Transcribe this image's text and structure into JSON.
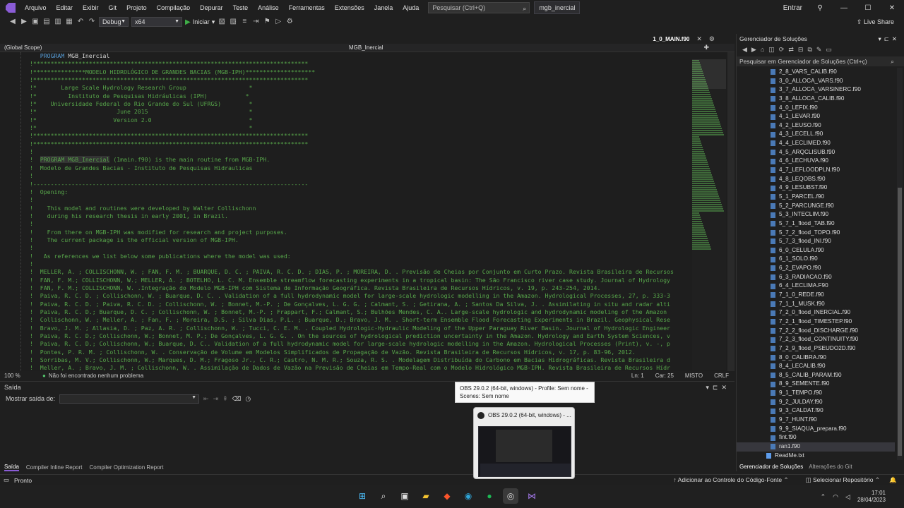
{
  "menu": {
    "items": [
      "Arquivo",
      "Editar",
      "Exibir",
      "Git",
      "Projeto",
      "Compilação",
      "Depurar",
      "Teste",
      "Análise",
      "Ferramentas",
      "Extensões",
      "Janela",
      "Ajuda"
    ],
    "search_placeholder": "Pesquisar (Ctrl+Q)",
    "solution_name": "mgb_inercial",
    "signin": "Entrar"
  },
  "toolbar": {
    "config": "Debug",
    "platform": "x64",
    "start": "Iniciar",
    "live_share": "Live Share"
  },
  "editor": {
    "tab": "1_0_MAIN.f90",
    "scope": "(Global Scope)",
    "member": "MGB_Inercial",
    "lines": [
      "   PROGRAM MGB_Inercial",
      "!*******************************************************************************",
      "!***************MODELO HIDROLÓGICO DE GRANDES BACIAS (MGB-IPH)********************",
      "!*******************************************************************************",
      "!*       Large Scale Hydrology Research Group                  *",
      "!*         Instituto de Pesquisas Hidráulicas (IPH)           *",
      "!*    Universidade Federal do Rio Grande do Sul (UFRGS)        *",
      "!*                       June 2015                             *",
      "!*                      Version 2.0                            *",
      "!*                                                             *",
      "!*******************************************************************************",
      "!*******************************************************************************",
      "!",
      "!  PROGRAM MGB_Inercial (1main.f90) is the main routine from MGB-IPH.",
      "!  Modelo de Grandes Bacias - Instituto de Pesquisas Hidraulicas",
      "!",
      "!-------------------------------------------------------------------------------",
      "!  Opening:",
      "!",
      "!    This model and routines were developed by Walter Collischonn",
      "!    during his research thesis in early 2001, in Brazil.",
      "!",
      "!    From there on MGB-IPH was modified for research and project purposes.",
      "!    The current package is the official version of MGB-IPH.",
      "!",
      "!   As references we list below some publications where the model was used:",
      "!",
      "!  MELLER, A. ; COLLISCHONN, W. ; FAN, F. M. ; BUARQUE, D. C. ; PAIVA, R. C. D. ; DIAS, P. ; MOREIRA, D. . Previsão de Cheias por Conjunto em Curto Prazo. Revista Brasileira de Recursos",
      "!  FAN, F. M.; COLLISCHONN, W.; MELLER, A. ; BOTELHO, L. C. M. Ensemble streamflow forecasting experiments in a tropical basin: The São Francisco river case study. Journal of Hydrology",
      "!  FAN, F. M.; COLLISCHONN, W. .Integração do Modelo MGB-IPH com Sistema de Informação Geográfica. Revista Brasileira de Recursos Hídricos, v. 19, p. 243-254, 2014.",
      "!  Paiva, R. C. D. ; Collischonn, W. ; Buarque, D. C. . Validation of a full hydrodynamic model for large-scale hydrologic modelling in the Amazon. Hydrological Processes, 27, p. 333-3",
      "!  Paiva, R. C. D. ; Paiva, R. C. D. ; Collischonn, W. ; Bonnet, M.-P. ; De Gonçalves, L. G. G. ; Calmant, S. ; Getirana, A. ; Santos Da Silva, J. . Assimilating in situ and radar alti",
      "!  Paiva, R. C. D.; Buarque, D. C. ; Collischonn, W. ; Bonnet, M.-P. ; Frappart, F.; Calmant, S.; Bulhões Mendes, C. A.. Large-scale hydrologic and hydrodynamic modeling of the Amazon",
      "!  Collischonn, W. ; Meller, A. ; Fan, F. ; Moreira, D.S. ; Silva Dias, P.L. ; Buarque, D.; Bravo, J. M. . Short-term Ensemble Flood Forecasting Experiments in Brazil. Geophysical Rese",
      "!  Bravo, J. M. ; Allasia, D. ; Paz, A. R. ; Collischonn, W. ; Tucci, C. E. M. . Coupled Hydrologic-Hydraulic Modeling of the Upper Paraguay River Basin. Journal of Hydrologic Engineer",
      "!  Paiva, R. C. D.; Collischonn, W.; Bonnet, M. P.; De Gonçalves, L. G. G. . On the sources of hydrological prediction uncertainty in the Amazon. Hydrology and Earth System Sciences, v",
      "!  Paiva, R. C. D.; Collischonn, W.; Buarque, D. C.. Validation of a full hydrodynamic model for large-scale hydrologic modelling in the Amazon. Hydrological Processes (Print), v. -, p",
      "!  Pontes, P. R. M. ; Collischonn, W. . Conservação de Volume em Modelos Simplificados de Propagação de Vazão. Revista Brasileira de Recursos Hídricos, v. 17, p. 83-96, 2012.",
      "!  Sorribas, M. V.; Collischonn, W.; Marques, D. M.; Fragoso Jr., C. R.; Castro, N. M. R.; Souza, R. S. . Modelagem Distribuída do Carbono em Bacias Hidrográficas. Revista Brasileira d",
      "!  Meller, A. ; Bravo, J. M. ; Collischonn, W. . Assimilação de Dados de Vazão na Previsão de Cheias em Tempo-Real com o Modelo Hidrológico MGB-IPH. Revista Brasileira de Recursos Hídr"
    ],
    "zoom": "100 %",
    "problems": "Não foi encontrado nenhum problema",
    "line": "Ln: 1",
    "col": "Car: 25",
    "mode": "MISTO",
    "eol": "CRLF"
  },
  "output": {
    "title": "Saída",
    "show_from_label": "Mostrar saída de:",
    "tabs": [
      "Saída",
      "Compiler Inline Report",
      "Compiler Optimization Report"
    ]
  },
  "solution": {
    "title": "Gerenciador de Soluções",
    "search_placeholder": "Pesquisar em Gerenciador de Soluções (Ctrl+ç)",
    "files": [
      "2_8_VARS_CALIB.f90",
      "3_0_ALLOCA_VARS.f90",
      "3_7_ALLOCA_VARSINERC.f90",
      "3_8_ALLOCA_CALIB.f90",
      "4_0_LEFIX.f90",
      "4_1_LEVAR.f90",
      "4_2_LEUSO.f90",
      "4_3_LECELL.f90",
      "4_4_LECLIMED.f90",
      "4_5_ARQCLISUB.f90",
      "4_6_LECHUVA.f90",
      "4_7_LEFLOODPLN.f90",
      "4_8_LEQOBS.f90",
      "4_9_LESUBST.f90",
      "5_1_PARCEL.f90",
      "5_2_PARCUNGE.f90",
      "5_3_INTECLIM.f90",
      "5_7_1_flood_TAB.f90",
      "5_7_2_flood_TOPO.f90",
      "5_7_3_flood_INI.f90",
      "6_0_CELULA.f90",
      "6_1_SOLO.f90",
      "6_2_EVAPO.f90",
      "6_3_RADIACAO.f90",
      "6_4_LECLIMA.F90",
      "7_1_0_REDE.f90",
      "7_1_1_MUSK.f90",
      "7_2_0_flood_INERCIAL.f90",
      "7_2_1_flood_TIMESTEP.f90",
      "7_2_2_flood_DISCHARGE.f90",
      "7_2_3_flood_CONTINUITY.f90",
      "7_2_9_flood_PSEUDO2D.f90",
      "8_0_CALIBRA.f90",
      "8_4_LECALIB.f90",
      "8_5_CALIB_PARAM.f90",
      "8_9_SEMENTE.f90",
      "9_1_TEMPO.f90",
      "9_2_JULDAY.f90",
      "9_3_CALDAT.f90",
      "9_7_HUNT.f90",
      "9_9_SIAQUA_prepara.f90",
      "fint.f90",
      "ran1.f90"
    ],
    "readme": "ReadMe.txt",
    "bottom_tabs": [
      "Gerenciador de Soluções",
      "Alterações do Git"
    ]
  },
  "statusbar": {
    "ready": "Pronto",
    "source_control": "Adicionar ao Controle do Código-Fonte",
    "repo": "Selecionar Repositório"
  },
  "tooltip": {
    "line1": "OBS 29.0.2 (64-bit, windows) - Profile: Sem nome -",
    "line2": "Scenes: Sem nome"
  },
  "thumbnail": {
    "title": "OBS 29.0.2 (64-bit, windows) - ..."
  },
  "taskbar": {
    "time": "17:01",
    "date": "28/04/2023"
  }
}
